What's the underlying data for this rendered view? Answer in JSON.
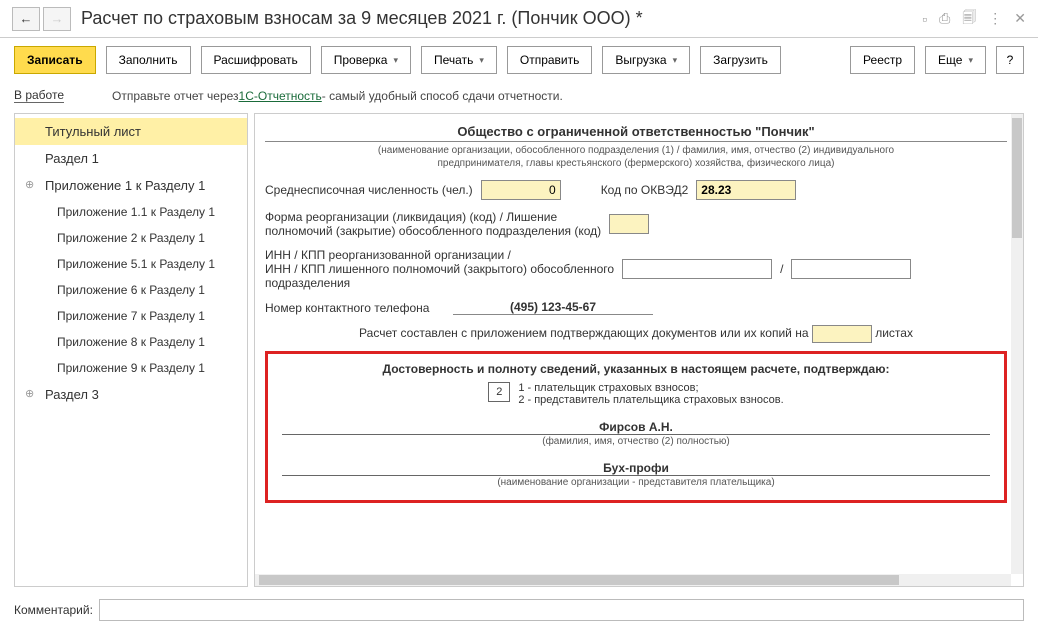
{
  "window": {
    "title": "Расчет по страховым взносам за 9 месяцев 2021 г. (Пончик ООО) *"
  },
  "toolbar": {
    "save": "Записать",
    "fill": "Заполнить",
    "decrypt": "Расшифровать",
    "check": "Проверка",
    "print": "Печать",
    "send": "Отправить",
    "upload": "Выгрузка",
    "load": "Загрузить",
    "registry": "Реестр",
    "more": "Еще",
    "help": "?"
  },
  "status": {
    "state": "В работе",
    "hint_before": "Отправьте отчет через ",
    "hint_link": "1С-Отчетность",
    "hint_after": " - самый удобный способ сдачи отчетности."
  },
  "tree": [
    {
      "t": "Титульный лист",
      "active": true
    },
    {
      "t": "Раздел 1"
    },
    {
      "t": "Приложение 1 к Разделу 1",
      "exp": true
    },
    {
      "t": "Приложение 1.1 к Разделу 1",
      "ind": 2
    },
    {
      "t": "Приложение 2 к Разделу 1",
      "ind": 2
    },
    {
      "t": "Приложение 5.1 к Разделу 1",
      "ind": 2
    },
    {
      "t": "Приложение 6 к Разделу 1",
      "ind": 2
    },
    {
      "t": "Приложение 7 к Разделу 1",
      "ind": 2
    },
    {
      "t": "Приложение 8 к Разделу 1",
      "ind": 2
    },
    {
      "t": "Приложение 9 к Разделу 1",
      "ind": 2
    },
    {
      "t": "Раздел 3",
      "exp": true
    }
  ],
  "form": {
    "org_name": "Общество с ограниченной ответственностью \"Пончик\"",
    "org_note1": "(наименование организации, обособленного подразделения (1) / фамилия, имя, отчество (2) индивидуального",
    "org_note2": "предпринимателя, главы крестьянского (фермерского) хозяйства, физического лица)",
    "avg_label": "Среднесписочная численность (чел.)",
    "avg_val": "0",
    "okved_label": "Код по ОКВЭД2",
    "okved_val": "28.23",
    "reorg_label1": "Форма реорганизации (ликвидация) (код) / Лишение",
    "reorg_label2": "полномочий (закрытие) обособленного подразделения (код)",
    "inn_label1": "ИНН / КПП реорганизованной организации /",
    "inn_label2": "ИНН / КПП лишенного полномочий (закрытого) обособленного",
    "inn_label3": "подразделения",
    "inn_sep": "/",
    "phone_label": "Номер контактного телефона",
    "phone": "(495) 123-45-67",
    "docs_prefix": "Расчет составлен с приложением подтверждающих документов или их копий на",
    "docs_suffix": "листах",
    "cert_title": "Достоверность и полноту сведений, указанных в настоящем расчете, подтверждаю:",
    "cert_code": "2",
    "cert_opt1": "1 - плательщик страховых взносов;",
    "cert_opt2": "2 - представитель плательщика страховых взносов.",
    "fio": "Фирсов А.Н.",
    "fio_note": "(фамилия, имя, отчество (2) полностью)",
    "rep": "Бух-профи",
    "rep_note": "(наименование организации - представителя плательщика)"
  },
  "comment_label": "Комментарий:"
}
